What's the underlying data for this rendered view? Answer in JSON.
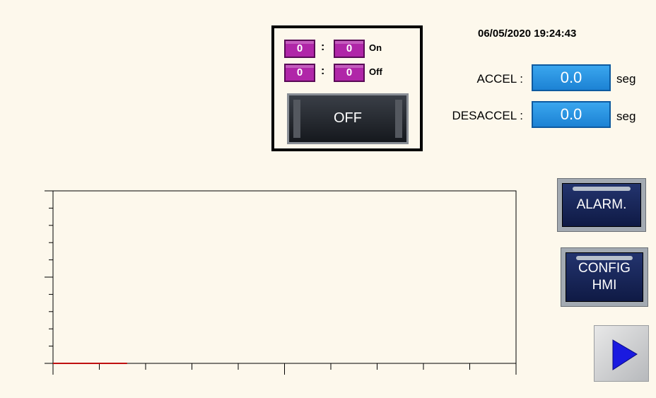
{
  "datetime": "06/05/2020 19:24:43",
  "timer": {
    "on": {
      "a": "0",
      "b": "0",
      "label": "On"
    },
    "off": {
      "a": "0",
      "b": "0",
      "label": "Off"
    },
    "colon": ":",
    "toggle_label": "OFF"
  },
  "fields": {
    "accel": {
      "label": "ACCEL :",
      "value": "0.0",
      "unit": "seg"
    },
    "desaccel": {
      "label": "DESACCEL :",
      "value": "0.0",
      "unit": "seg"
    }
  },
  "buttons": {
    "alarm": "ALARM.",
    "config_line1": "CONFIG",
    "config_line2": "HMI"
  },
  "icons": {
    "next": "play-arrow-icon"
  },
  "colors": {
    "background": "#fdf8ec",
    "timer_value": "#b026a8",
    "field_value": "#1c82d4",
    "button_dark": "#15204f",
    "trend_line": "#c01010",
    "next_arrow": "#1a1ae0"
  },
  "chart_data": {
    "type": "line",
    "title": "",
    "xlabel": "",
    "ylabel": "",
    "grid": false,
    "x_major_ticks": 3,
    "x_minor_per_major": 5,
    "y_major_ticks": 3,
    "y_minor_per_major": 5,
    "series": [
      {
        "x": [
          0,
          0.16
        ],
        "values": [
          0,
          0
        ]
      }
    ],
    "xlim": [
      0,
      1
    ],
    "ylim": [
      0,
      1
    ]
  }
}
